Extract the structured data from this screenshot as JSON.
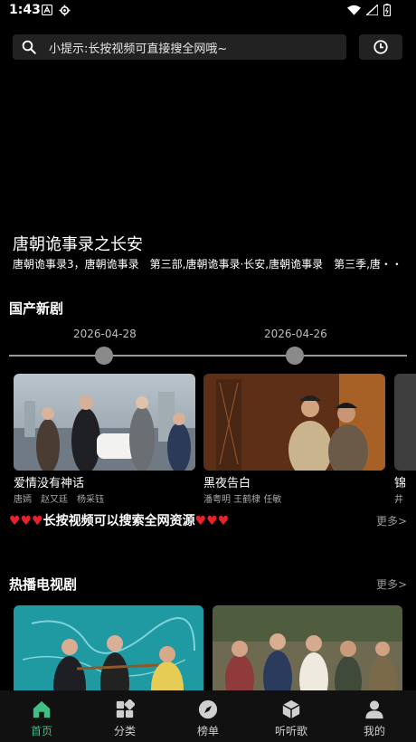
{
  "status_bar": {
    "time": "1:43"
  },
  "search": {
    "placeholder": "小提示:长按视频可直接搜全网哦~"
  },
  "banner": {
    "title": "唐朝诡事录之长安",
    "subtitle": "唐朝诡事录3，唐朝诡事录　第三部,唐朝诡事录·长安,唐朝诡事录　第三季,唐・・"
  },
  "domestic_new": {
    "title": "国产新剧",
    "dates": [
      "2026-04-28",
      "2026-04-26"
    ],
    "items": [
      {
        "name": "爱情没有神话",
        "cast": "唐嫣　赵又廷　杨采钰"
      },
      {
        "name": "黑夜告白",
        "cast": "潘粤明 王鹤棣 任敏"
      },
      {
        "name": "锦",
        "cast": "井"
      }
    ]
  },
  "tip": {
    "hearts": "♥♥♥",
    "text": "长按视频可以搜索全网资源",
    "more": "更多>"
  },
  "hot_tv": {
    "title": "热播电视剧",
    "more": "更多>"
  },
  "nav": {
    "home": "首页",
    "category": "分类",
    "ranking": "榜单",
    "music": "听听歌",
    "mine": "我的"
  },
  "colors": {
    "accent": "#3fbf86",
    "heart": "#e8232b",
    "surface": "#222222"
  }
}
